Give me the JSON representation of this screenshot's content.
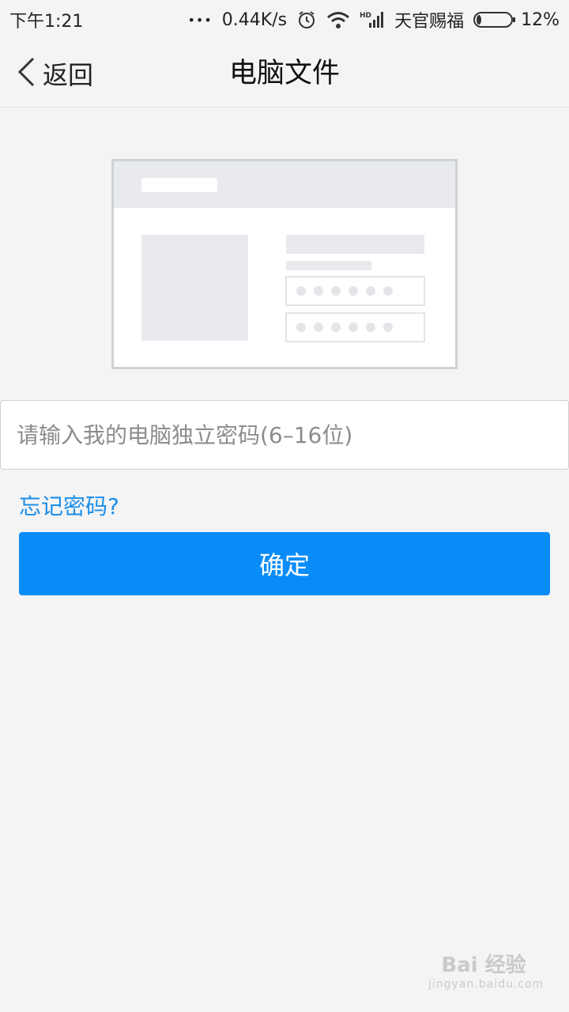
{
  "status_bar": {
    "time": "下午1:21",
    "more": "•••",
    "network_speed": "0.44K/s",
    "carrier": "天官赐福",
    "battery_percent": "12%",
    "battery_level": 0.12,
    "icons": [
      "alarm-icon",
      "wifi-icon",
      "hd-signal-icon",
      "battery-icon"
    ]
  },
  "nav": {
    "back_label": "返回",
    "title": "电脑文件"
  },
  "form": {
    "password_placeholder": "请输入我的电脑独立密码(6–16位)",
    "password_value": "",
    "forgot_label": "忘记密码?",
    "confirm_label": "确定"
  },
  "watermark": {
    "brand": "Bai 经验",
    "url": "jingyan.baidu.com"
  },
  "colors": {
    "accent": "#0a8cf8",
    "link": "#1a8eea",
    "background": "#f4f4f4"
  }
}
